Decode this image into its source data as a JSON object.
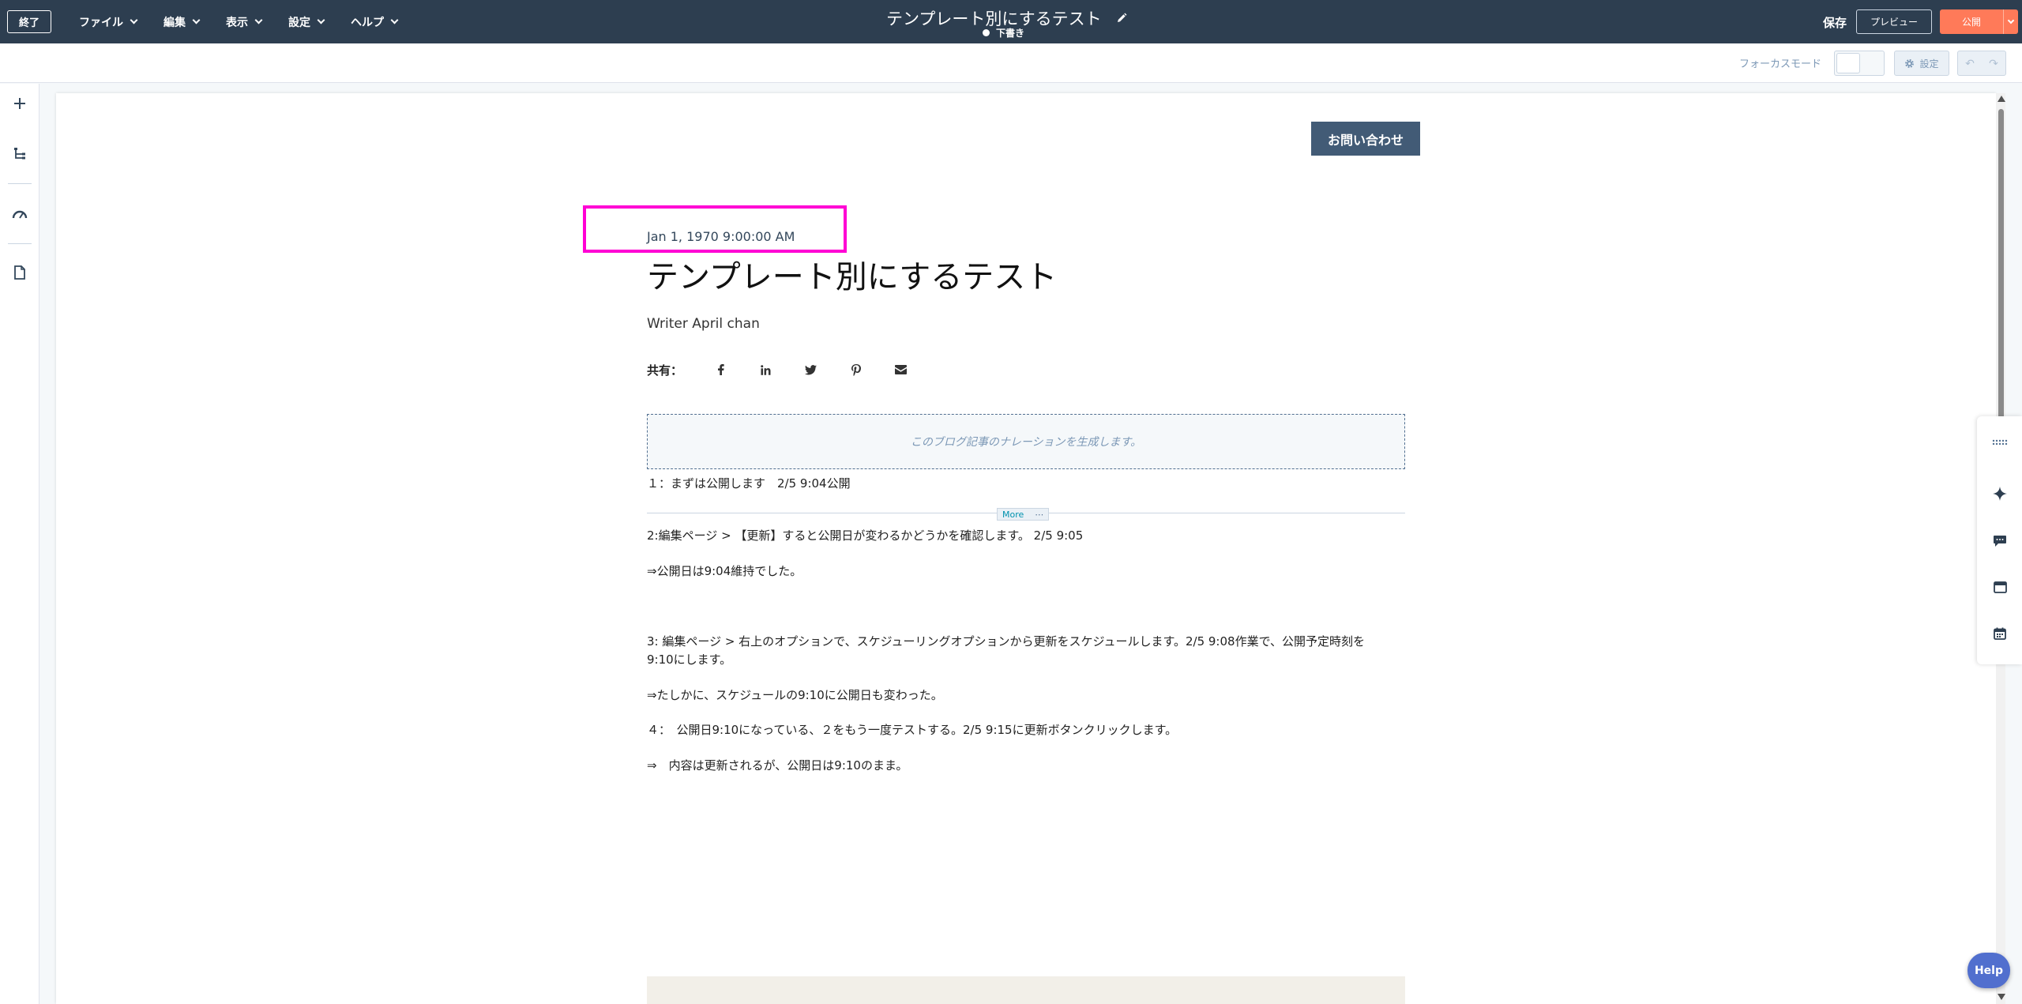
{
  "topbar": {
    "exit_label": "終了",
    "menu": [
      {
        "label": "ファイル"
      },
      {
        "label": "編集"
      },
      {
        "label": "表示"
      },
      {
        "label": "設定"
      },
      {
        "label": "ヘルプ"
      }
    ],
    "document_title": "テンプレート別にするテスト",
    "status": "下書き",
    "save_label": "保存",
    "preview_label": "プレビュー",
    "publish_label": "公開"
  },
  "subbar": {
    "focus_mode_label": "フォーカスモード",
    "settings_label": "設定"
  },
  "canvas": {
    "contact_button": "お問い合わせ",
    "post_date": "Jan 1, 1970 9:00:00 AM",
    "post_title": "テンプレート別にするテスト",
    "author": "Writer April chan",
    "share_label": "共有：",
    "narration_placeholder": "このブログ記事のナレーションを生成します。",
    "more_label": "More",
    "lines": [
      "１：まずは公開します　2/5 9:04公開",
      "2:編集ページ > 【更新】すると公開日が変わるかどうかを確認します。 2/5 9:05",
      "⇒公開日は9:04維持でした。",
      "3: 編集ページ > 右上のオプションで、スケジューリングオプションから更新をスケジュールします。2/5 9:08作業で、公開予定時刻を",
      "9:10にします。",
      "⇒たしかに、スケジュールの9:10に公開日も変わった。",
      "４：　公開日9:10になっている、２をもう一度テストする。2/5 9:15に更新ボタンクリックします。",
      "⇒　内容は更新されるが、公開日は9:10のまま。"
    ]
  },
  "help_label": "Help",
  "colors": {
    "topbar": "#2d3e50",
    "publish": "#ff7a59",
    "highlight": "#ff00d4",
    "contact_button": "#425b76"
  }
}
